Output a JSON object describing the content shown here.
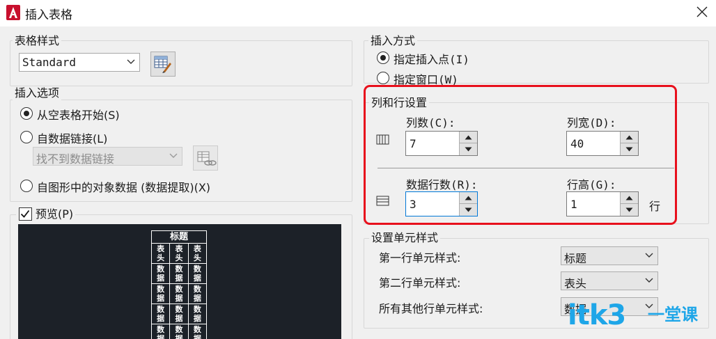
{
  "window": {
    "title": "插入表格",
    "app_icon": "autocad-logo-icon",
    "close_icon": "close-icon"
  },
  "table_style": {
    "group_label": "表格样式",
    "selected": "Standard",
    "launch_icon": "table-style-dialog-icon"
  },
  "insert_options": {
    "group_label": "插入选项",
    "options": [
      {
        "label": "从空表格开始(S)",
        "selected": true
      },
      {
        "label": "自数据链接(L)",
        "selected": false
      },
      {
        "label": "自图形中的对象数据 (数据提取)(X)",
        "selected": false
      }
    ],
    "data_link_placeholder": "找不到数据链接",
    "data_link_icon": "data-link-manager-icon"
  },
  "preview": {
    "label": "预览(P)",
    "checked": true,
    "table_title": "标题",
    "header_cells": [
      "表头",
      "表头",
      "表头"
    ],
    "data_cell": "数据",
    "background": "#1c2128"
  },
  "insert_method": {
    "group_label": "插入方式",
    "options": [
      {
        "label": "指定插入点(I)",
        "selected": true
      },
      {
        "label": "指定窗口(W)",
        "selected": false
      }
    ]
  },
  "column_row": {
    "group_label": "列和行设置",
    "columns_label": "列数(C):",
    "columns_value": "7",
    "column_width_label": "列宽(D):",
    "column_width_value": "40",
    "data_rows_label": "数据行数(R):",
    "data_rows_value": "3",
    "row_height_label": "行高(G):",
    "row_height_value": "1",
    "row_height_unit": "行",
    "columns_icon": "columns-icon",
    "rows_icon": "rows-icon"
  },
  "cell_styles": {
    "group_label": "设置单元样式",
    "first_row_label": "第一行单元样式:",
    "first_row_value": "标题",
    "second_row_label": "第二行单元样式:",
    "second_row_value": "表头",
    "other_rows_label": "所有其他行单元样式:",
    "other_rows_value": "数据"
  },
  "watermark": {
    "text": "itk3",
    "cn": "一堂课"
  },
  "colors": {
    "highlight": "#e8101c",
    "accent": "#0078d7",
    "watermark": "#1ea6e8"
  }
}
